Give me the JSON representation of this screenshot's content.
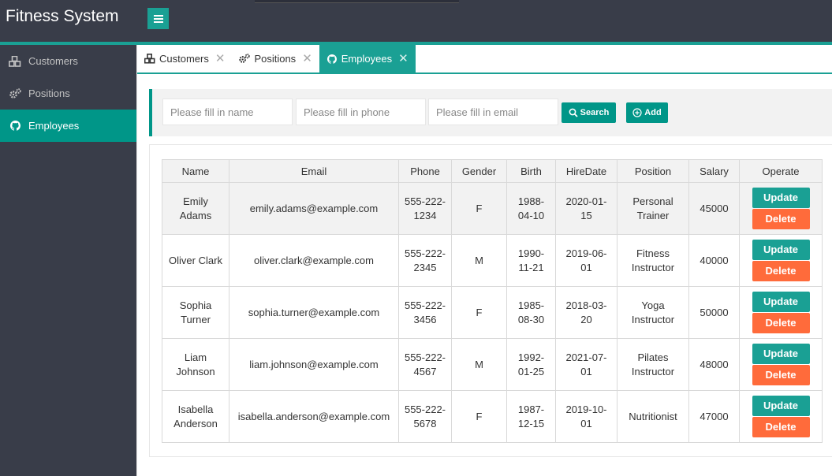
{
  "app": {
    "title": "Fitness System"
  },
  "sidebar": {
    "items": [
      {
        "label": "Customers",
        "icon": "cubes-icon"
      },
      {
        "label": "Positions",
        "icon": "gears-icon"
      },
      {
        "label": "Employees",
        "icon": "github-icon",
        "active": true
      }
    ]
  },
  "tabs": [
    {
      "label": "Customers",
      "icon": "cubes-icon"
    },
    {
      "label": "Positions",
      "icon": "gears-icon"
    },
    {
      "label": "Employees",
      "icon": "github-icon",
      "active": true
    }
  ],
  "search": {
    "name_placeholder": "Please fill in name",
    "phone_placeholder": "Please fill in phone",
    "email_placeholder": "Please fill in email",
    "search_label": "Search",
    "add_label": "Add"
  },
  "table": {
    "columns": [
      "Name",
      "Email",
      "Phone",
      "Gender",
      "Birth",
      "HireDate",
      "Position",
      "Salary",
      "Operate"
    ],
    "update_label": "Update",
    "delete_label": "Delete",
    "rows": [
      {
        "name": "Emily Adams",
        "email": "emily.adams@example.com",
        "phone": "555-222-1234",
        "gender": "F",
        "birth": "1988-04-10",
        "hire": "2020-01-15",
        "position": "Personal Trainer",
        "salary": "45000"
      },
      {
        "name": "Oliver Clark",
        "email": "oliver.clark@example.com",
        "phone": "555-222-2345",
        "gender": "M",
        "birth": "1990-11-21",
        "hire": "2019-06-01",
        "position": "Fitness Instructor",
        "salary": "40000"
      },
      {
        "name": "Sophia Turner",
        "email": "sophia.turner@example.com",
        "phone": "555-222-3456",
        "gender": "F",
        "birth": "1985-08-30",
        "hire": "2018-03-20",
        "position": "Yoga Instructor",
        "salary": "50000"
      },
      {
        "name": "Liam Johnson",
        "email": "liam.johnson@example.com",
        "phone": "555-222-4567",
        "gender": "M",
        "birth": "1992-01-25",
        "hire": "2021-07-01",
        "position": "Pilates Instructor",
        "salary": "48000"
      },
      {
        "name": "Isabella Anderson",
        "email": "isabella.anderson@example.com",
        "phone": "555-222-5678",
        "gender": "F",
        "birth": "1987-12-15",
        "hire": "2019-10-01",
        "position": "Nutritionist",
        "salary": "47000"
      }
    ]
  },
  "colors": {
    "header": "#393d49",
    "accent": "#009688",
    "update": "#1aa094",
    "delete": "#ff6b3b"
  }
}
